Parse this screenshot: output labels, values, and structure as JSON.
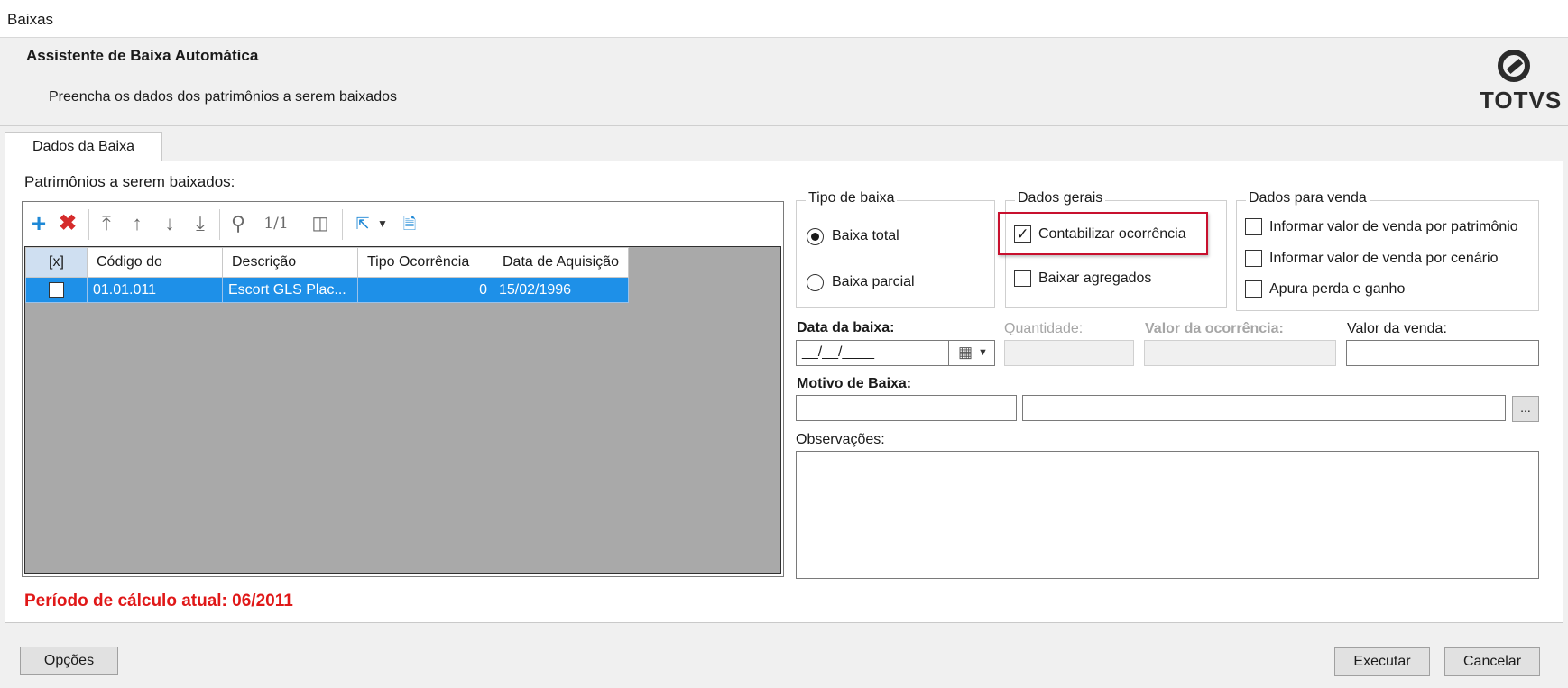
{
  "window": {
    "title": "Baixas"
  },
  "header": {
    "title": "Assistente de Baixa Automática",
    "subtitle": "Preencha os dados dos patrimônios a serem baixados",
    "logo_text": "TOTVS"
  },
  "tabs": [
    {
      "label": "Dados da Baixa"
    }
  ],
  "grid": {
    "caption": "Patrimônios a serem baixados:",
    "page_indicator": "1/1",
    "columns": [
      "[x]",
      "Código do",
      "Descrição",
      "Tipo Ocorrência",
      "Data de Aquisição"
    ],
    "rows": [
      {
        "selected": false,
        "codigo": "01.01.011",
        "descricao": "Escort GLS Plac...",
        "tipo": "0",
        "data": "15/02/1996"
      }
    ]
  },
  "periodo": "Período de cálculo atual: 06/2011",
  "tipo_baixa": {
    "legend": "Tipo de baixa",
    "options": [
      {
        "label": "Baixa total",
        "checked": true
      },
      {
        "label": "Baixa parcial",
        "checked": false
      }
    ]
  },
  "dados_gerais": {
    "legend": "Dados gerais",
    "options": [
      {
        "label": "Contabilizar ocorrência",
        "checked": true
      },
      {
        "label": "Baixar agregados",
        "checked": false
      }
    ]
  },
  "dados_venda": {
    "legend": "Dados para venda",
    "options": [
      {
        "label": "Informar valor de venda por patrimônio",
        "checked": false
      },
      {
        "label": "Informar valor de venda por cenário",
        "checked": false
      },
      {
        "label": "Apura perda e ganho",
        "checked": false
      }
    ]
  },
  "fields": {
    "data_baixa_label": "Data da baixa:",
    "data_baixa_value": "__/__/____",
    "quantidade_label": "Quantidade:",
    "valor_ocorrencia_label": "Valor da ocorrência:",
    "valor_venda_label": "Valor da venda:",
    "motivo_label": "Motivo de Baixa:",
    "motivo_lookup": "...",
    "observacoes_label": "Observações:"
  },
  "buttons": {
    "opcoes": "Opções",
    "executar": "Executar",
    "cancelar": "Cancelar"
  },
  "colors": {
    "accent": "#1e90e8",
    "error": "#e01818",
    "highlight": "#c8102e"
  }
}
